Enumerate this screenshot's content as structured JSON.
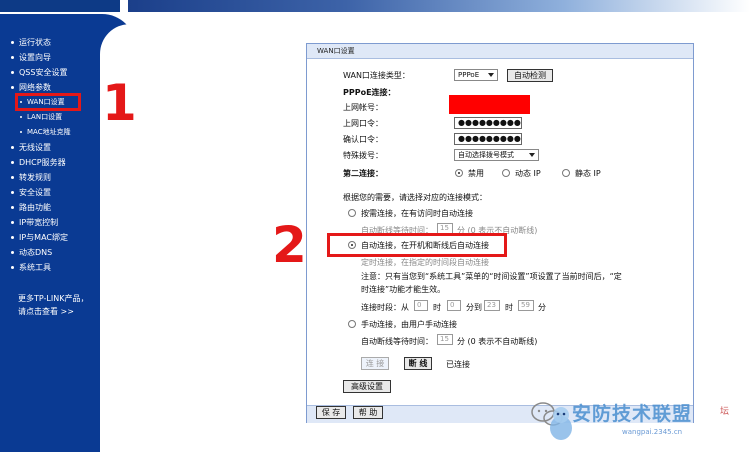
{
  "sidebar": {
    "items": [
      {
        "label": "运行状态"
      },
      {
        "label": "设置向导"
      },
      {
        "label": "QSS安全设置"
      },
      {
        "label": "网络参数"
      },
      {
        "label": "WAN口设置"
      },
      {
        "label": "LAN口设置"
      },
      {
        "label": "MAC地址克隆"
      },
      {
        "label": "无线设置"
      },
      {
        "label": "DHCP服务器"
      },
      {
        "label": "转发规则"
      },
      {
        "label": "安全设置"
      },
      {
        "label": "路由功能"
      },
      {
        "label": "IP带宽控制"
      },
      {
        "label": "IP与MAC绑定"
      },
      {
        "label": "动态DNS"
      },
      {
        "label": "系统工具"
      }
    ],
    "more_line1": "更多TP-LINK产品，",
    "more_line2": "请点击查看 >>"
  },
  "annotations": {
    "step1": "1",
    "step2": "2"
  },
  "panel": {
    "title": "WAN口设置",
    "wan_type_label": "WAN口连接类型：",
    "wan_type_value": "PPPoE",
    "auto_detect": "自动检测",
    "pppoe_header": "PPPoE连接：",
    "account_label": "上网帐号：",
    "password_label": "上网口令：",
    "password_value": "●●●●●●●●●",
    "confirm_label": "确认口令：",
    "confirm_value": "●●●●●●●●●",
    "dial_label": "特殊拨号：",
    "dial_value": "自动选择拨号模式",
    "second_label": "第二连接：",
    "second_opts": [
      "禁用",
      "动态 IP",
      "静态 IP"
    ],
    "mode_prompt": "根据您的需要，请选择对应的连接模式：",
    "mode_demand": "按需连接，在有访问时自动连接",
    "idle_label_1": "自动断线等待时间：",
    "idle_value_1": "15",
    "idle_suffix_1": "分 (0 表示不自动断线)",
    "mode_auto": "自动连接，在开机和断线后自动连接",
    "mode_timed": "定时连接，在指定的时间段自动连接",
    "note_line1": "注意：只有当您到“系统工具”菜单的“时间设置”项设置了当前时间后，“定",
    "note_line2": "时连接”功能才能生效。",
    "time_label": "连接时段：从",
    "time_from_h": "0",
    "time_h": "时",
    "time_from_m": "0",
    "time_to": "分到",
    "time_to_h": "23",
    "time_to_m": "59",
    "time_m": "分",
    "mode_manual": "手动连接，由用户手动连接",
    "idle_label_2": "自动断线等待时间：",
    "idle_value_2": "15",
    "idle_suffix_2": "分 (0 表示不自动断线)",
    "connect_btn": "连 接",
    "disconnect_btn": "断 线",
    "status": "已连接",
    "advanced_btn": "高级设置",
    "save_btn": "保 存",
    "help_btn": "帮 助"
  },
  "watermark": {
    "title": "安防技术联盟",
    "suffix": "坛",
    "url": "wangpai.2345.cn"
  },
  "colors": {
    "sidebar": "#0a3a93",
    "highlight": "#e41818",
    "panel_header": "#dfe8f7"
  }
}
